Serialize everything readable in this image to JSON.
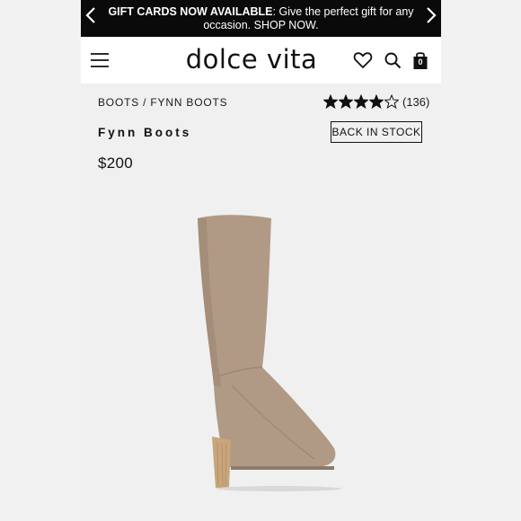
{
  "promo": {
    "bold": "GIFT CARDS NOW AVAILABLE",
    "text_line1": ": Give the perfect gift for any",
    "text_line2": "occasion. SHOP NOW."
  },
  "header": {
    "logo": "dolce vita",
    "icons": [
      "menu-icon",
      "heart-icon",
      "search-icon",
      "bag-icon"
    ],
    "bag_count": "0"
  },
  "product": {
    "breadcrumb": [
      "BOOTS",
      "FYNN BOOTS"
    ],
    "breadcrumb_separator": " / ",
    "rating": 4,
    "rating_max": 5,
    "review_count": "(136)",
    "name": "Fynn Boots",
    "stock_status": "BACK IN STOCK",
    "price": "$200"
  },
  "colors": {
    "boot": "#b09a86",
    "heel": "#c9a57c",
    "background": "#f0f0f0"
  }
}
